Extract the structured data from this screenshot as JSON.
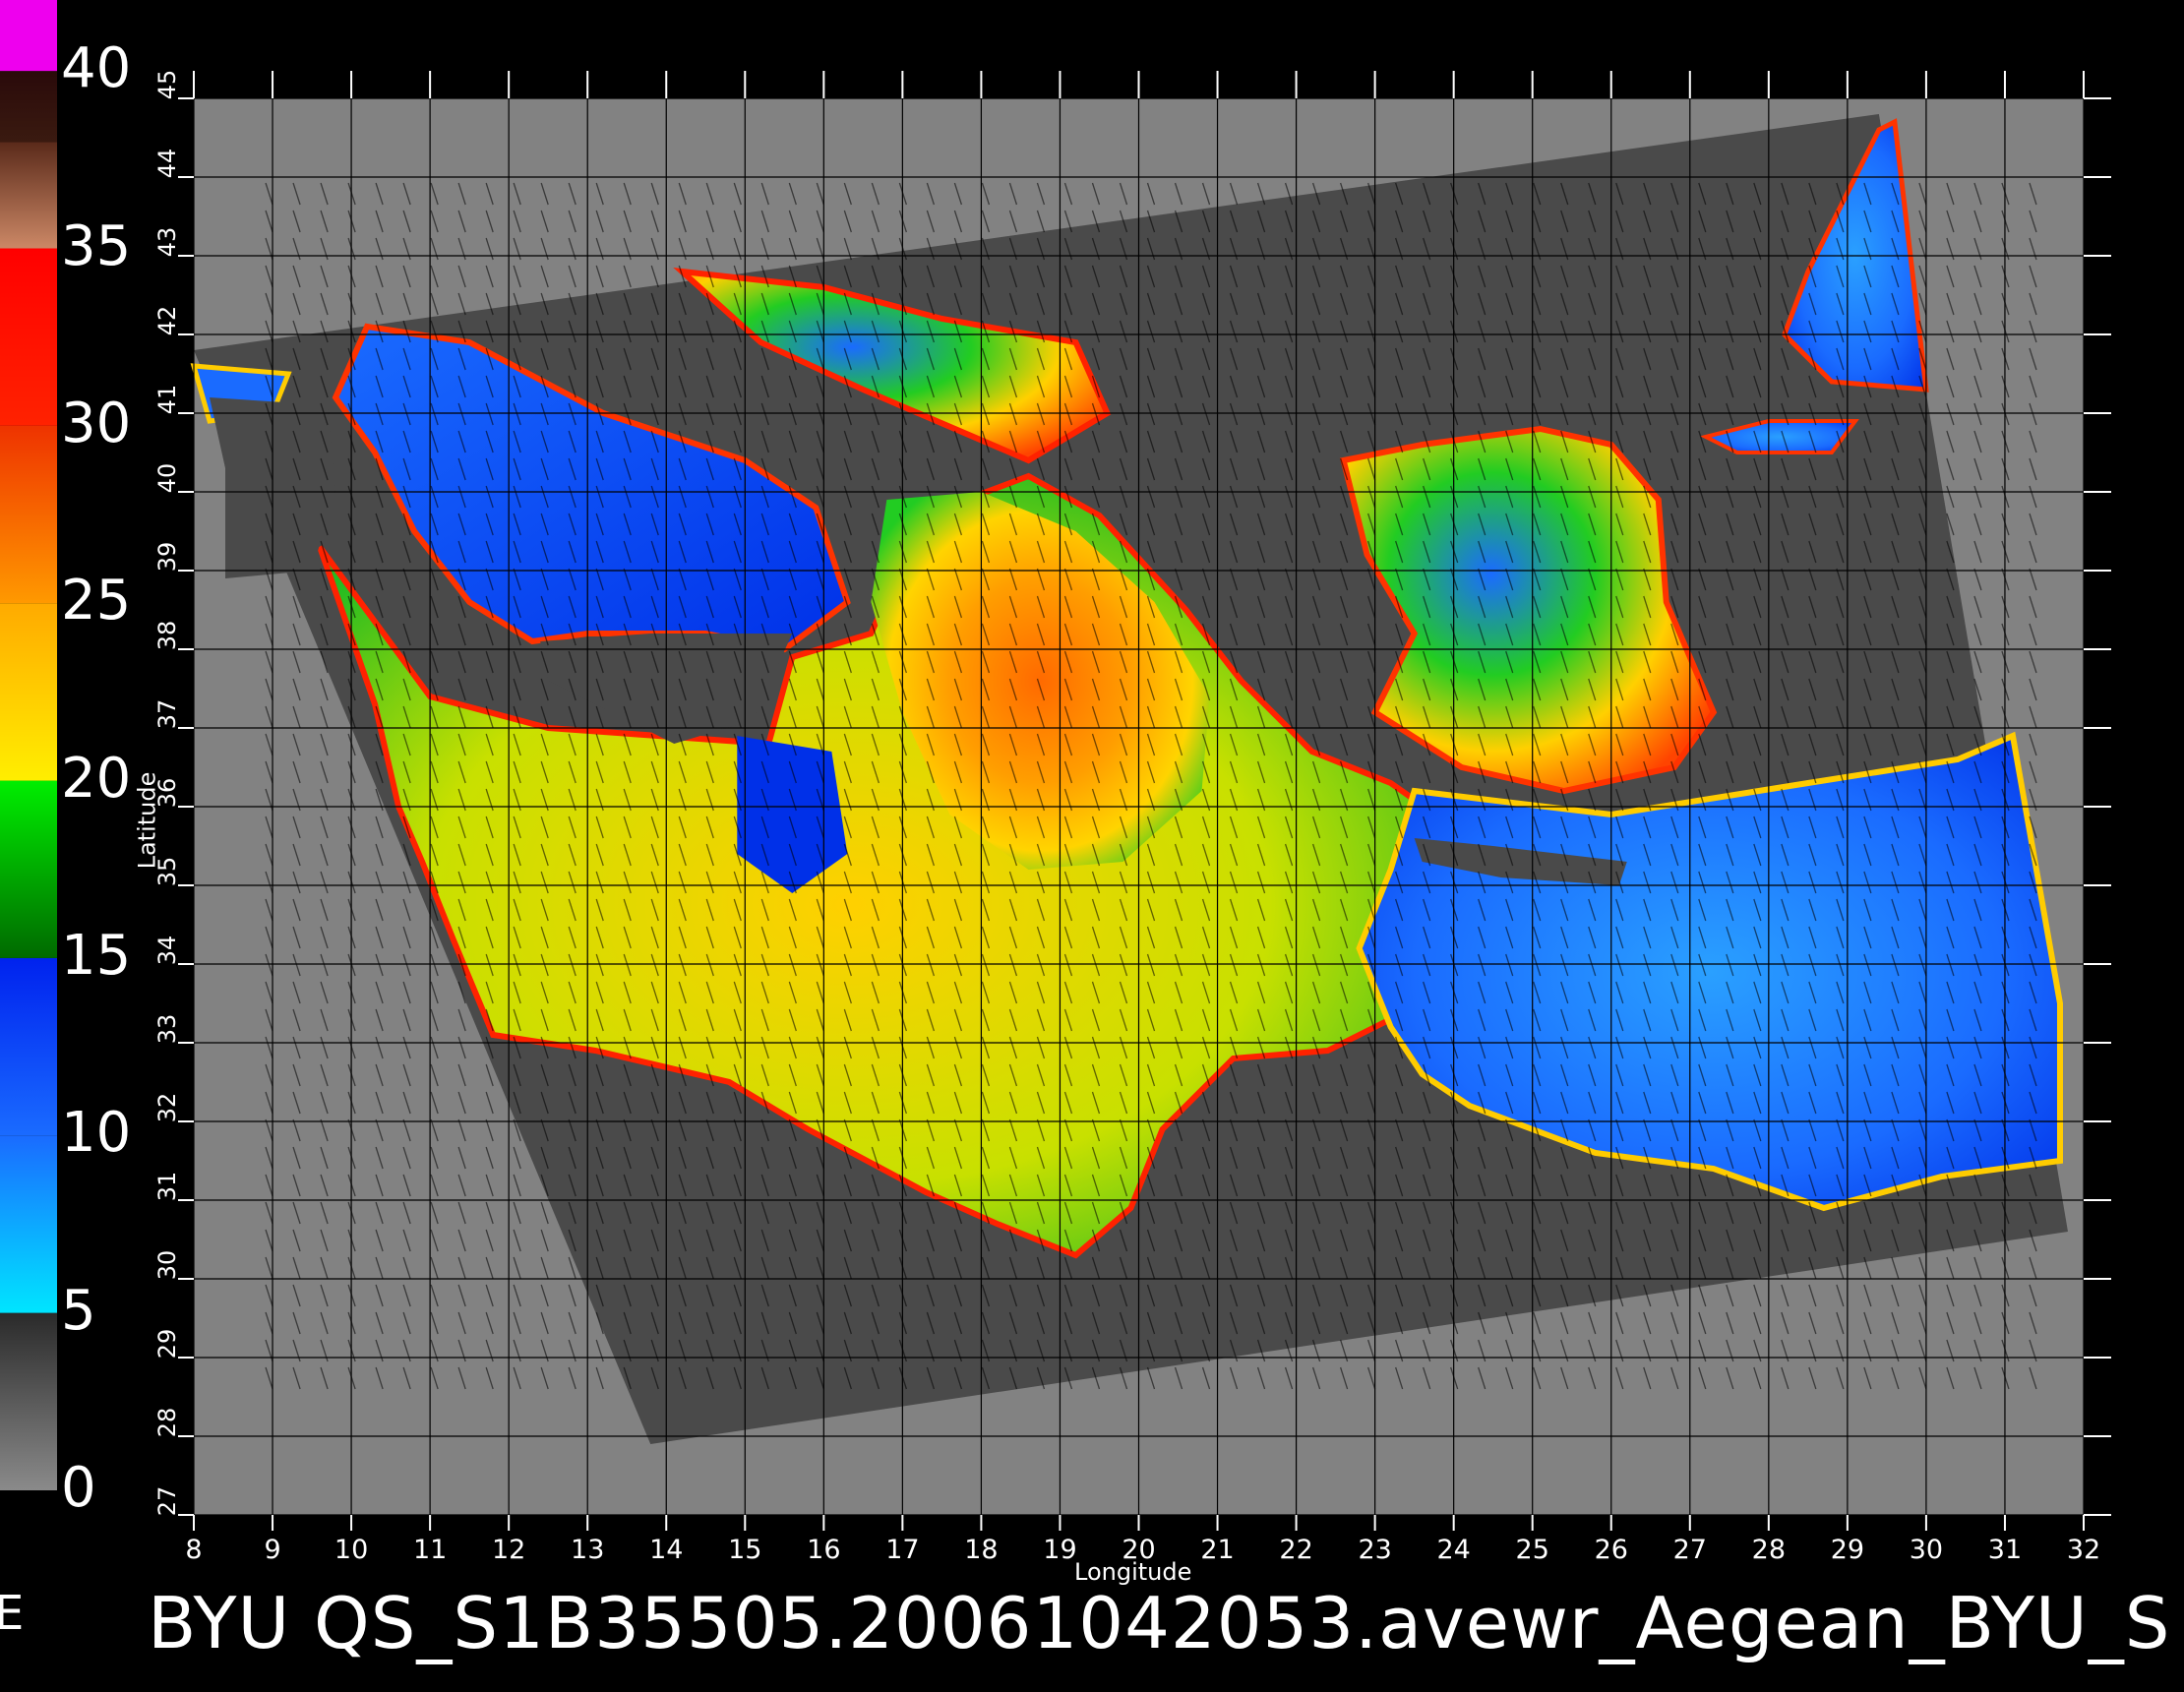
{
  "colorbar": {
    "labels": [
      "0",
      "5",
      "10",
      "15",
      "20",
      "25",
      "30",
      "35",
      "40"
    ],
    "bands": [
      {
        "from": 0,
        "to": 5,
        "gradient": [
          "#8a8a8a",
          "#2a2a2a"
        ]
      },
      {
        "from": 5,
        "to": 10,
        "gradient": [
          "#00e5ff",
          "#1a6bff"
        ]
      },
      {
        "from": 10,
        "to": 15,
        "gradient": [
          "#1a6bff",
          "#0022ee"
        ]
      },
      {
        "from": 15,
        "to": 20,
        "gradient": [
          "#006a00",
          "#00ee00"
        ]
      },
      {
        "from": 20,
        "to": 25,
        "gradient": [
          "#ffee00",
          "#ffaa00"
        ]
      },
      {
        "from": 25,
        "to": 30,
        "gradient": [
          "#ff9900",
          "#ee3300"
        ]
      },
      {
        "from": 30,
        "to": 35,
        "gradient": [
          "#ff2200",
          "#ff0000"
        ]
      },
      {
        "from": 35,
        "to": 38,
        "gradient": [
          "#cc8866",
          "#5a2a1a"
        ]
      },
      {
        "from": 38,
        "to": 40,
        "gradient": [
          "#3a1a10",
          "#2a0a0a"
        ]
      },
      {
        "from": 40,
        "to": 42,
        "gradient": [
          "#ee00ee",
          "#ee00ee"
        ]
      }
    ]
  },
  "map": {
    "x_axis": {
      "label": "Longitude",
      "ticks": [
        "8",
        "9",
        "10",
        "11",
        "12",
        "13",
        "14",
        "15",
        "16",
        "17",
        "18",
        "19",
        "20",
        "21",
        "22",
        "23",
        "24",
        "25",
        "26",
        "27",
        "28",
        "29",
        "30",
        "31",
        "32"
      ]
    },
    "y_axis": {
      "label": "Latitude",
      "ticks": [
        "27",
        "28",
        "29",
        "30",
        "31",
        "32",
        "33",
        "34",
        "35",
        "36",
        "37",
        "38",
        "39",
        "40",
        "41",
        "42",
        "43",
        "44",
        "45"
      ]
    },
    "lon_range": [
      8,
      32
    ],
    "lat_range": [
      27,
      45
    ],
    "colors": {
      "land_background": "#828282",
      "swath": "#4a4a4a",
      "grid": "#000000"
    },
    "icons": [
      "wind-vector-field"
    ]
  },
  "footer": {
    "title": "BYU  QS_S1B35505.20061042053.avewr_Aegean_BYU_S",
    "left_fragment": "E"
  }
}
